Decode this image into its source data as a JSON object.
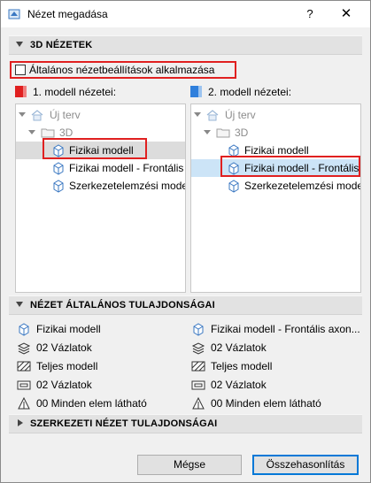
{
  "window": {
    "title": "Nézet megadása",
    "help": "?",
    "close": "✕"
  },
  "sections": {
    "views3d": "3D NÉZETEK",
    "general": "NÉZET ÁLTALÁNOS TULAJDONSÁGAI",
    "structural": "SZERKEZETI NÉZET TULAJDONSÁGAI"
  },
  "checkbox": {
    "label": "Általános nézetbeállítások alkalmazása",
    "checked": false
  },
  "model1": {
    "heading": "1. modell nézetei:",
    "color": "#e02020",
    "tree": {
      "root": "Új terv",
      "folder": "3D",
      "items": [
        "Fizikai modell",
        "Fizikai modell - Frontális",
        "Szerkezetelemzési modell"
      ]
    }
  },
  "model2": {
    "heading": "2. modell nézetei:",
    "color": "#2f7fdc",
    "tree": {
      "root": "Új terv",
      "folder": "3D",
      "items": [
        "Fizikai modell",
        "Fizikai modell - Frontális",
        "Szerkezetelemzési modell"
      ]
    }
  },
  "props_left": [
    "Fizikai modell",
    "02 Vázlatok",
    "Teljes modell",
    "02 Vázlatok",
    "00 Minden elem látható"
  ],
  "props_right": [
    "Fizikai modell - Frontális axon...",
    "02 Vázlatok",
    "Teljes modell",
    "02 Vázlatok",
    "00 Minden elem látható"
  ],
  "buttons": {
    "cancel": "Mégse",
    "compare": "Összehasonlítás"
  },
  "icons": [
    "app-icon",
    "house-icon",
    "folder-icon",
    "cube-view-icon",
    "layers-icon",
    "hatch-icon",
    "pen-set-icon",
    "visibility-icon"
  ]
}
